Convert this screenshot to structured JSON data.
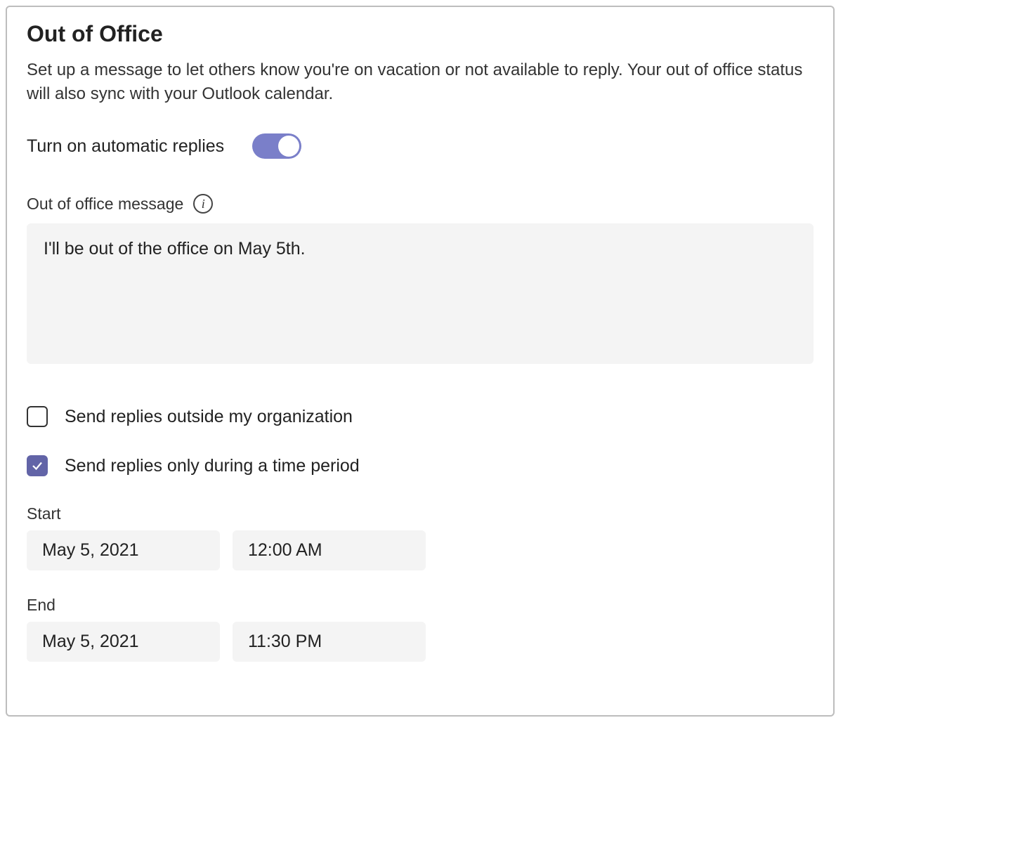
{
  "title": "Out of Office",
  "description": "Set up a message to let others know you're on vacation or not available to reply. Your out of office status will also sync with your Outlook calendar.",
  "toggle": {
    "label": "Turn on automatic replies",
    "on": true
  },
  "message": {
    "label": "Out of office message",
    "value": "I'll be out of the office on May 5th."
  },
  "checkboxes": {
    "outside_org": {
      "label": "Send replies outside my organization",
      "checked": false
    },
    "time_period": {
      "label": "Send replies only during a time period",
      "checked": true
    }
  },
  "time": {
    "start_label": "Start",
    "start_date": "May 5, 2021",
    "start_time": "12:00 AM",
    "end_label": "End",
    "end_date": "May 5, 2021",
    "end_time": "11:30 PM"
  }
}
